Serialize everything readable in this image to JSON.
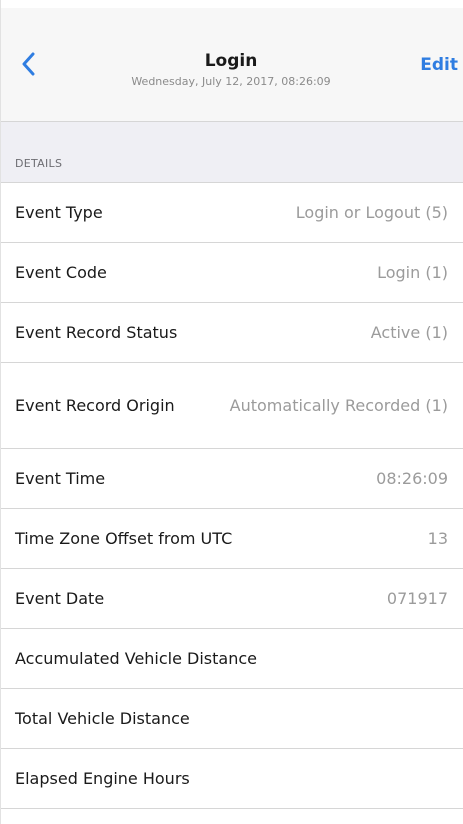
{
  "nav": {
    "back_icon": "chevron-left-icon",
    "title": "Login",
    "subtitle": "Wednesday, July 12, 2017, 08:26:09",
    "edit_label": "Edit",
    "accent_color": "#2f7de1"
  },
  "section": {
    "label": "DETAILS"
  },
  "rows": [
    {
      "label": "Event Type",
      "value": "Login or Logout (5)"
    },
    {
      "label": "Event Code",
      "value": "Login (1)"
    },
    {
      "label": "Event Record Status",
      "value": "Active (1)"
    },
    {
      "label": "Event Record Origin",
      "value": "Automatically Recorded (1)"
    },
    {
      "label": "Event Time",
      "value": "08:26:09"
    },
    {
      "label": "Time Zone Offset from UTC",
      "value": "13"
    },
    {
      "label": "Event Date",
      "value": "071917"
    },
    {
      "label": "Accumulated Vehicle Distance",
      "value": ""
    },
    {
      "label": "Total Vehicle Distance",
      "value": ""
    },
    {
      "label": "Elapsed Engine Hours",
      "value": ""
    }
  ]
}
